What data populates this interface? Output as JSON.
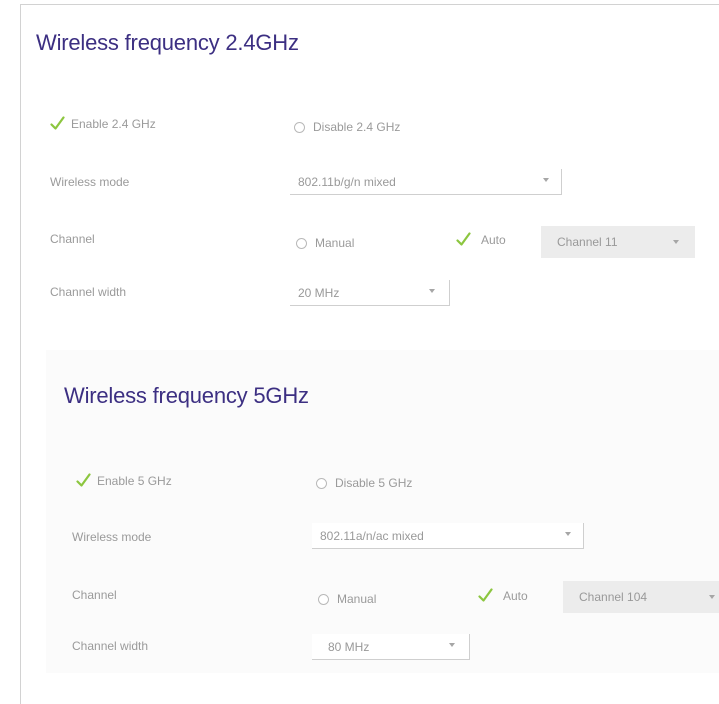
{
  "sections": [
    {
      "title": "Wireless frequency 2.4GHz",
      "enable_label": "Enable 2.4 GHz",
      "disable_label": "Disable 2.4 GHz",
      "wireless_mode_label": "Wireless mode",
      "wireless_mode_value": "802.11b/g/n mixed",
      "channel_label": "Channel",
      "manual_label": "Manual",
      "auto_label": "Auto",
      "channel_value": "Channel 11",
      "channel_width_label": "Channel width",
      "channel_width_value": "20 MHz"
    },
    {
      "title": "Wireless frequency 5GHz",
      "enable_label": "Enable 5 GHz",
      "disable_label": "Disable 5 GHz",
      "wireless_mode_label": "Wireless mode",
      "wireless_mode_value": "802.11a/n/ac mixed",
      "channel_label": "Channel",
      "manual_label": "Manual",
      "auto_label": "Auto",
      "channel_value": "Channel 104",
      "channel_width_label": "Channel width",
      "channel_width_value": "80 MHz"
    }
  ],
  "colors": {
    "title": "#3c2f82",
    "check": "#8cc63f",
    "label": "#9a9a9a"
  }
}
